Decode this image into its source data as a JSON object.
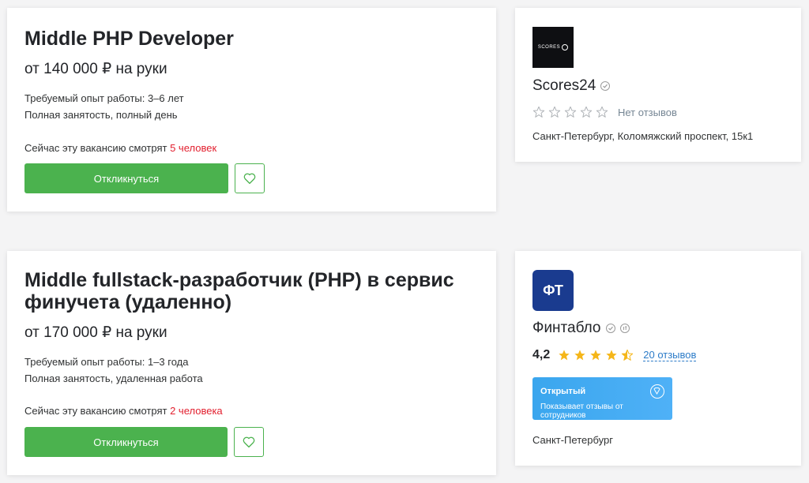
{
  "vacancies": [
    {
      "title": "Middle PHP Developer",
      "salary": "от 140 000 ₽ на руки",
      "experience": "Требуемый опыт работы: 3–6 лет",
      "employment": "Полная занятость, полный день",
      "watch_prefix": "Сейчас эту вакансию смотрят ",
      "watch_count": "5 человек",
      "apply_label": "Откликнуться"
    },
    {
      "title_line1": "Middle fullstack-разработчик (PHP) в сервис",
      "title_line2": "финучета (удаленно)",
      "salary": "от 170 000 ₽ на руки",
      "experience": "Требуемый опыт работы: 1–3 года",
      "employment": "Полная занятость, удаленная работа",
      "watch_prefix": "Сейчас эту вакансию смотрят ",
      "watch_count": "2 человека",
      "apply_label": "Откликнуться"
    }
  ],
  "companies": [
    {
      "name": "Scores24",
      "logo_text": "SCORES",
      "logo_bg": "#0e0f12",
      "rating_text": "Нет отзывов",
      "stars_filled": 0,
      "address": "Санкт-Петербург, Коломяжский проспект, 15к1"
    },
    {
      "name": "Финтабло",
      "logo_text": "ФТ",
      "logo_bg": "#1a3b8f",
      "rating_value": "4,2",
      "stars_filled": 4.5,
      "reviews_link": "20 отзывов",
      "open_title": "Открытый",
      "open_sub": "Показывает отзывы от сотрудников",
      "address": "Санкт-Петербург"
    }
  ],
  "colors": {
    "accent_green": "#4bb24e",
    "highlight_red": "#e2202f",
    "star_gold": "#f5b619",
    "link_blue": "#2d7cc8"
  }
}
